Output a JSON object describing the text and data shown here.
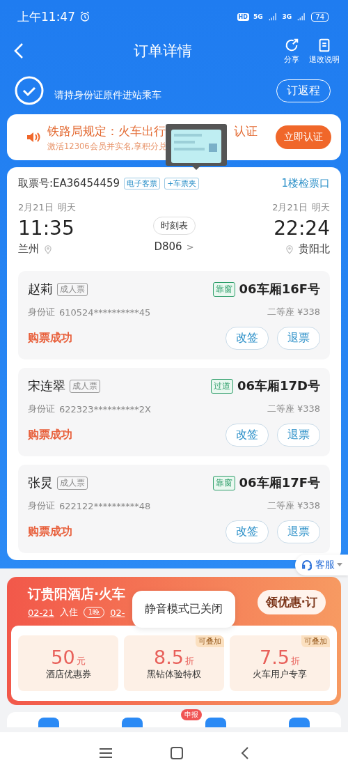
{
  "status_bar": {
    "time": "上午11:47",
    "battery": "74",
    "net_a": "5G",
    "net_b": "3G",
    "hd": "HD"
  },
  "header": {
    "title": "订单详情",
    "actions": [
      "分享",
      "退改说明"
    ]
  },
  "success": {
    "subtitle": "请持身份证原件进站乘车",
    "button": "订返程"
  },
  "notice": {
    "title_start": "铁路局规定：火车出行",
    "title_end": "认证",
    "subtitle": "激活12306会员并实名,享积分兑",
    "button": "立即认证"
  },
  "order": {
    "pickup": "取票号:EA36454459",
    "tags": [
      "电子客票",
      "+车票夹"
    ],
    "gate": "1楼检票口",
    "depart": {
      "date": "2月21日",
      "day": "明天",
      "time": "11:35",
      "station": "兰州"
    },
    "arrive": {
      "date": "2月21日",
      "day": "明天",
      "time": "22:24",
      "station": "贵阳北"
    },
    "timetable": "时刻表",
    "train": "D806",
    "train_arrow": ">"
  },
  "passengers": [
    {
      "name": "赵莉",
      "type": "成人票",
      "id_label": "身份证",
      "id": "610524**********45",
      "seat_tag": "靠窗",
      "seat": "06车厢16F号",
      "class_price": "二等座 ¥338",
      "status": "购票成功",
      "buttons": [
        "改签",
        "退票"
      ]
    },
    {
      "name": "宋连翠",
      "type": "成人票",
      "id_label": "身份证",
      "id": "622323**********2X",
      "seat_tag": "过道",
      "seat": "06车厢17D号",
      "class_price": "二等座 ¥338",
      "status": "购票成功",
      "buttons": [
        "改签",
        "退票"
      ]
    },
    {
      "name": "张炅",
      "type": "成人票",
      "id_label": "身份证",
      "id": "622122**********48",
      "seat_tag": "靠窗",
      "seat": "06车厢17F号",
      "class_price": "二等座 ¥338",
      "status": "购票成功",
      "buttons": [
        "改签",
        "退票"
      ]
    }
  ],
  "service": {
    "label": "客服"
  },
  "hotel": {
    "title": "订贵阳酒店·火车",
    "checkin": "02-21",
    "checkin_label": "入住",
    "nights": "1晚",
    "checkout": "02-",
    "button": "领优惠·订",
    "coupons": [
      {
        "value": "50",
        "unit": "元",
        "label": "酒店优惠券"
      },
      {
        "value": "8.5",
        "unit": "折",
        "label": "黑钻体验特权",
        "badge": "可叠加"
      },
      {
        "value": "7.5",
        "unit": "折",
        "label": "火车用户专享",
        "badge": "可叠加"
      }
    ]
  },
  "toast": "静音模式已关闭",
  "shortcut_badge": "申报"
}
